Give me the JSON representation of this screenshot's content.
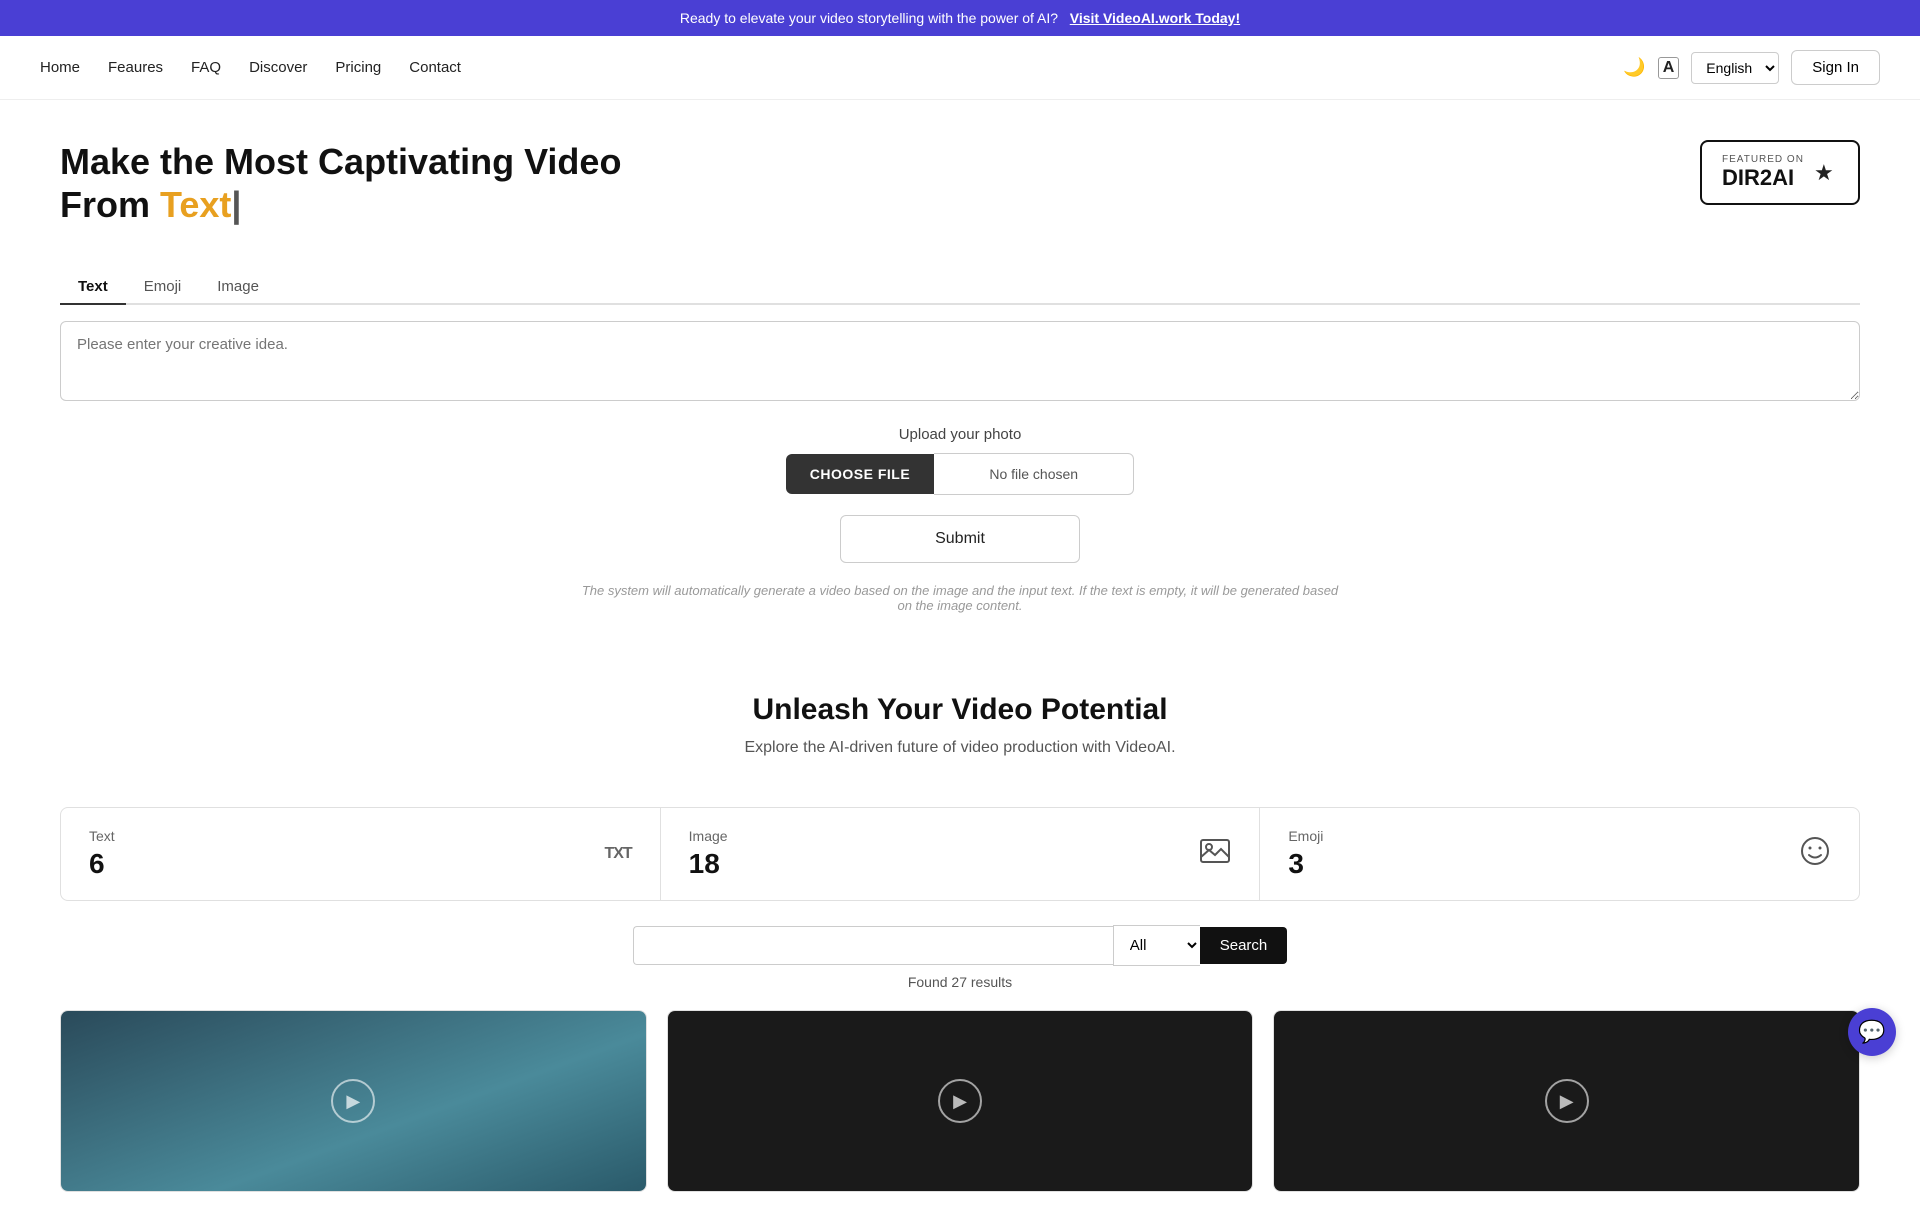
{
  "banner": {
    "text": "Ready to elevate your video storytelling with the power of AI?",
    "link_text": "Visit VideoAI.work Today!"
  },
  "nav": {
    "links": [
      {
        "label": "Home",
        "id": "home"
      },
      {
        "label": "Feaures",
        "id": "features"
      },
      {
        "label": "FAQ",
        "id": "faq"
      },
      {
        "label": "Discover",
        "id": "discover"
      },
      {
        "label": "Pricing",
        "id": "pricing"
      },
      {
        "label": "Contact",
        "id": "contact"
      }
    ],
    "language": "English",
    "sign_in": "Sign In",
    "dark_mode_icon": "🌙",
    "translate_icon": "A"
  },
  "hero": {
    "title_line1": "Make the Most Captivating Video",
    "title_line2_start": "From ",
    "title_highlight": "Text",
    "title_cursor": "|",
    "badge_featured": "FEATURED ON",
    "badge_name": "DIR2AI",
    "badge_star": "★"
  },
  "form": {
    "tabs": [
      {
        "label": "Text",
        "active": true
      },
      {
        "label": "Emoji",
        "active": false
      },
      {
        "label": "Image",
        "active": false
      }
    ],
    "textarea_placeholder": "Please enter your creative idea.",
    "upload_label": "Upload your photo",
    "choose_file_btn": "CHOOSE FILE",
    "no_file_chosen": "No file chosen",
    "submit_btn": "Submit",
    "submit_note": "The system will automatically generate a video based on the image and the input text. If the text is empty, it will be generated based on the image content."
  },
  "unleash": {
    "title": "Unleash Your Video Potential",
    "subtitle": "Explore the AI-driven future of video production with VideoAI."
  },
  "stats": [
    {
      "label": "Text",
      "number": "6",
      "icon": "TXT"
    },
    {
      "label": "Image",
      "number": "18",
      "icon": "🖼"
    },
    {
      "label": "Emoji",
      "number": "3",
      "icon": "🙂"
    }
  ],
  "search": {
    "placeholder": "",
    "filter_default": "All",
    "search_btn": "Search",
    "results_text": "Found 27 results"
  },
  "chat_icon": "💬"
}
